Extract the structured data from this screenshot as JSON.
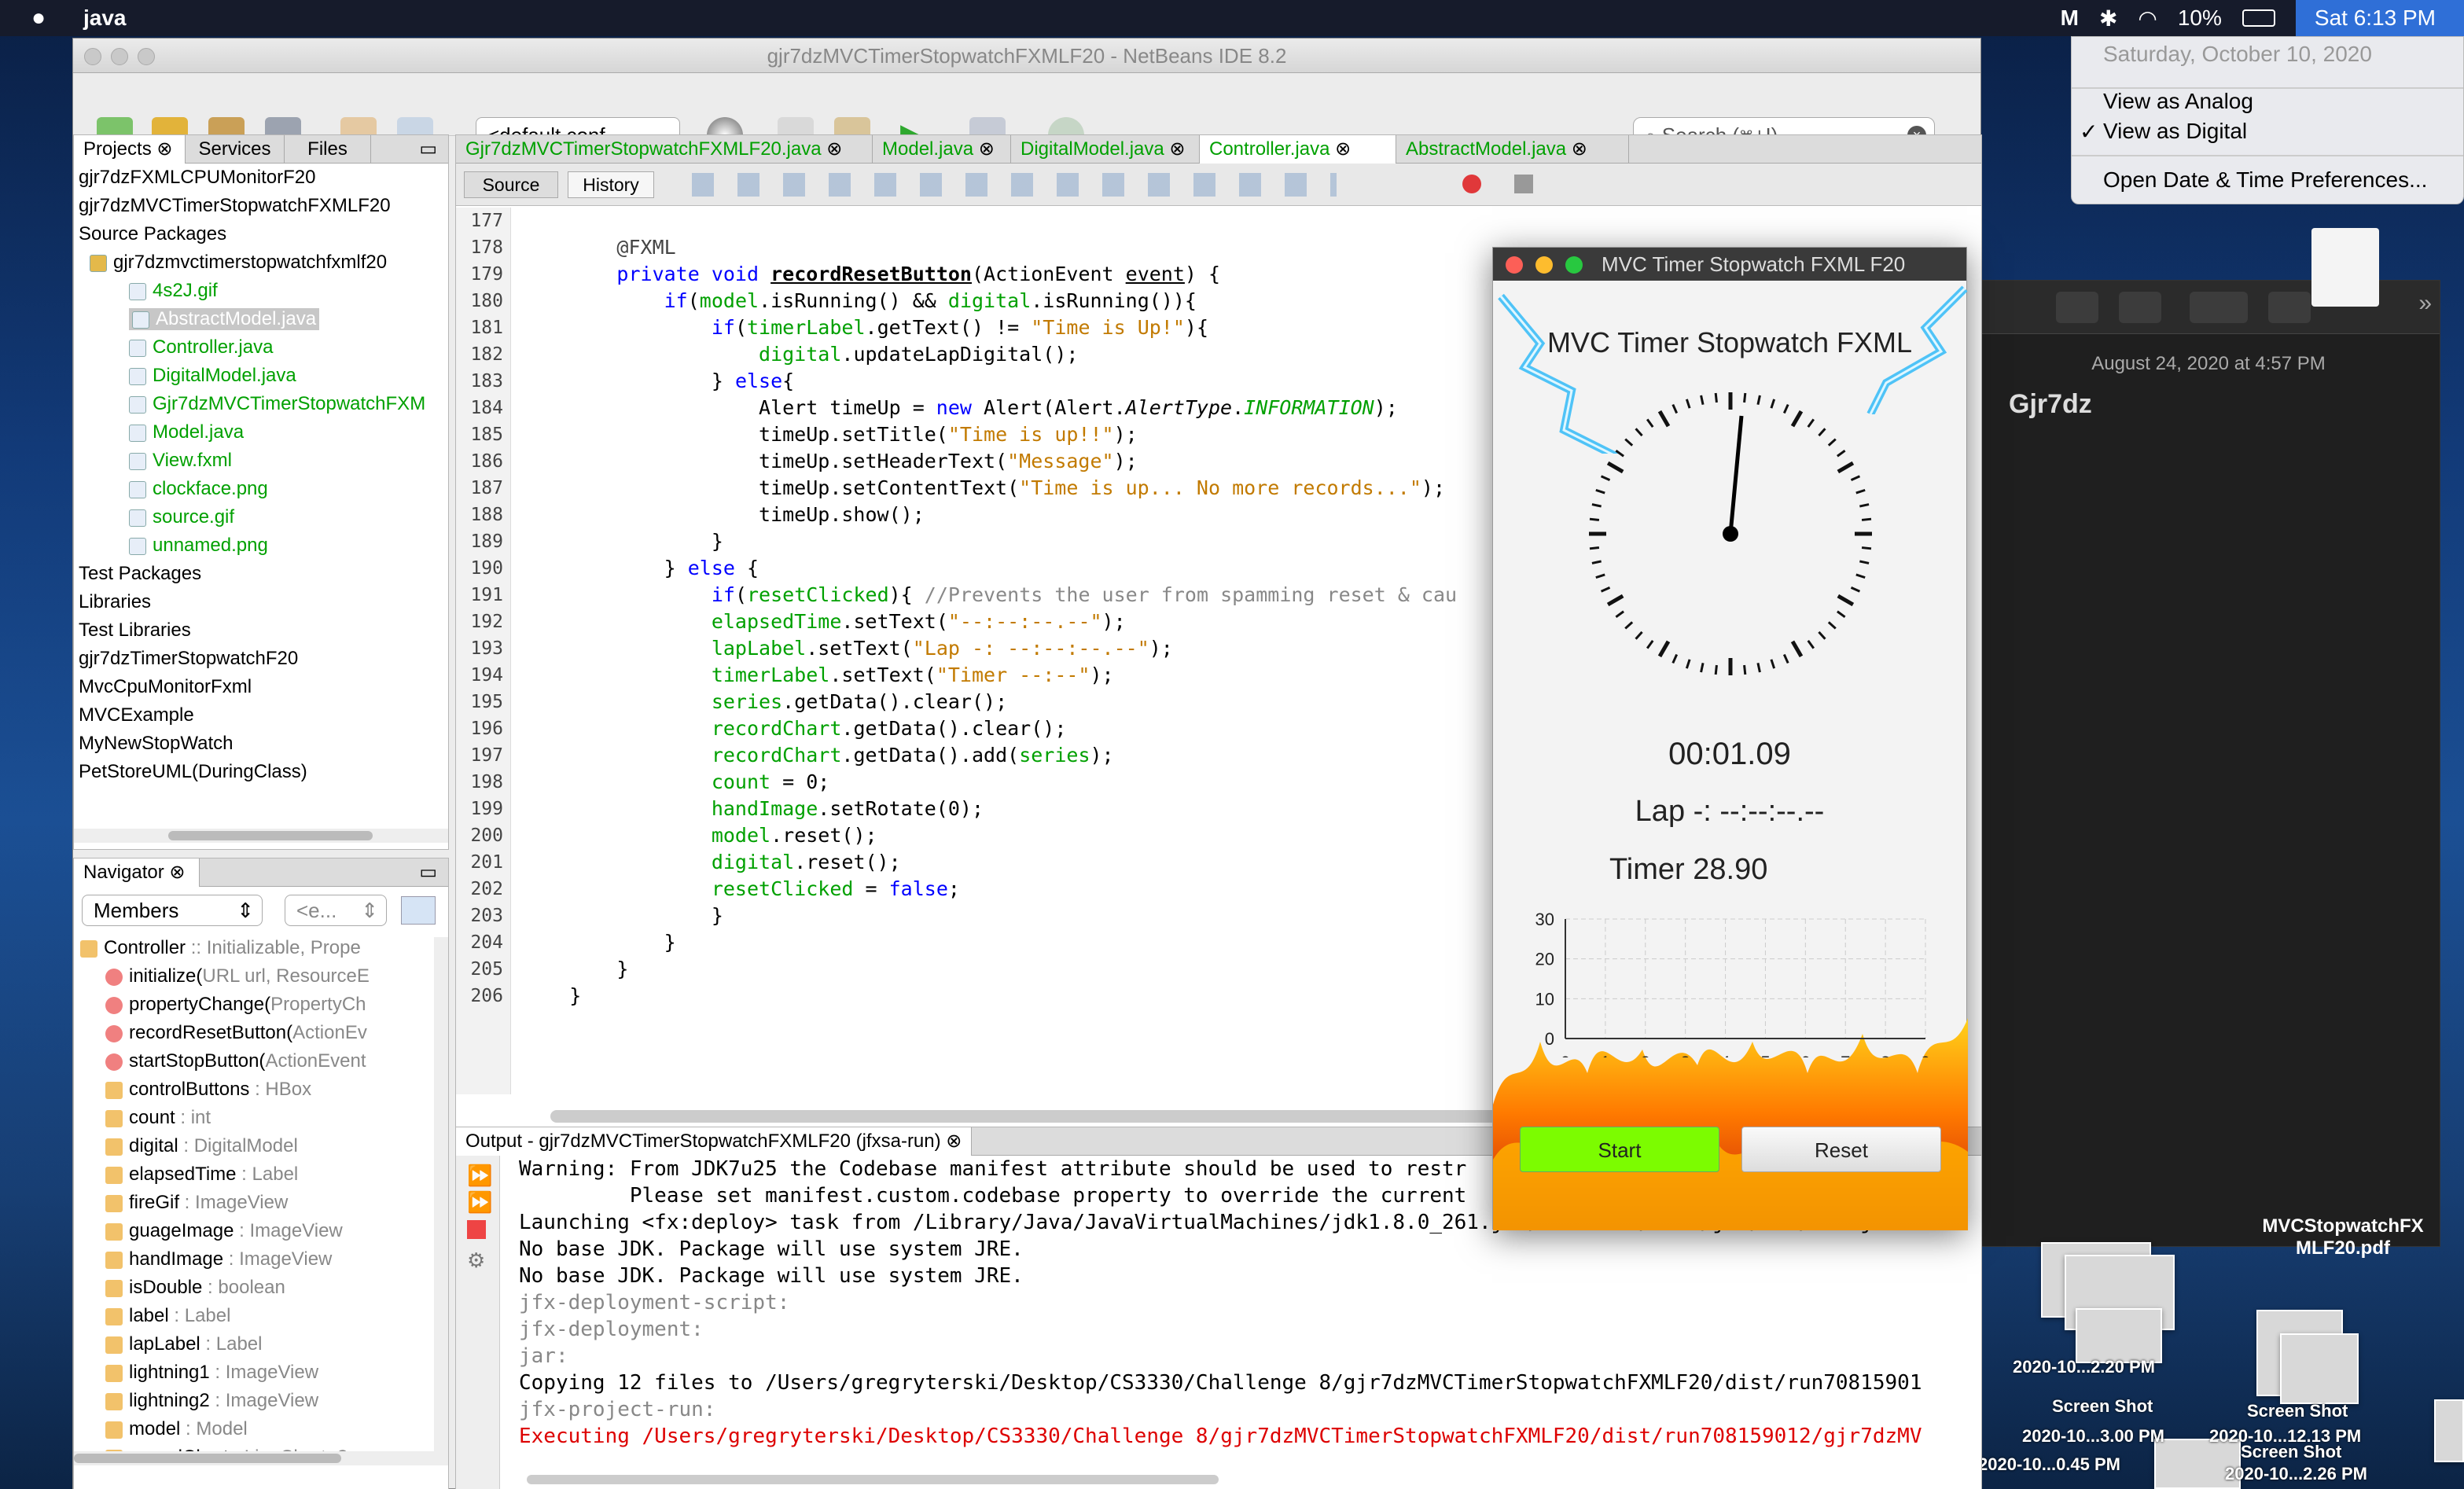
{
  "menubar": {
    "app": "java",
    "battery": "10%",
    "clock": "Sat 6:13 PM"
  },
  "datemenu": {
    "header": "Saturday, October 10, 2020",
    "items": [
      "View as Analog",
      "View as Digital",
      "Open Date & Time Preferences..."
    ],
    "checked": 1
  },
  "netbeans": {
    "title": "gjr7dzMVCTimerStopwatchFXMLF20 - NetBeans IDE 8.2",
    "config": "<default conf...",
    "search_placeholder": "Search (⌘+I)",
    "project_tabs": [
      "Projects",
      "Services",
      "Files"
    ],
    "project_tree": [
      {
        "t": "gjr7dzFXMLCPUMonitorF20",
        "d": 0,
        "c": ""
      },
      {
        "t": "gjr7dzMVCTimerStopwatchFXMLF20",
        "d": 0,
        "c": ""
      },
      {
        "t": "Source Packages",
        "d": 0,
        "c": ""
      },
      {
        "t": "gjr7dzmvctimerstopwatchfxmlf20",
        "d": 1,
        "c": ""
      },
      {
        "t": "4s2J.gif",
        "d": 2,
        "c": "g"
      },
      {
        "t": "AbstractModel.java",
        "d": 2,
        "c": "sel"
      },
      {
        "t": "Controller.java",
        "d": 2,
        "c": "g"
      },
      {
        "t": "DigitalModel.java",
        "d": 2,
        "c": "g"
      },
      {
        "t": "Gjr7dzMVCTimerStopwatchFXM",
        "d": 2,
        "c": "g"
      },
      {
        "t": "Model.java",
        "d": 2,
        "c": "g"
      },
      {
        "t": "View.fxml",
        "d": 2,
        "c": "g"
      },
      {
        "t": "clockface.png",
        "d": 2,
        "c": "g"
      },
      {
        "t": "source.gif",
        "d": 2,
        "c": "g"
      },
      {
        "t": "unnamed.png",
        "d": 2,
        "c": "g"
      },
      {
        "t": "Test Packages",
        "d": 0,
        "c": ""
      },
      {
        "t": "Libraries",
        "d": 0,
        "c": ""
      },
      {
        "t": "Test Libraries",
        "d": 0,
        "c": ""
      },
      {
        "t": "gjr7dzTimerStopwatchF20",
        "d": 0,
        "c": ""
      },
      {
        "t": "MvcCpuMonitorFxml",
        "d": 0,
        "c": ""
      },
      {
        "t": "MVCExample",
        "d": 0,
        "c": ""
      },
      {
        "t": "MyNewStopWatch",
        "d": 0,
        "c": ""
      },
      {
        "t": "PetStoreUML(DuringClass)",
        "d": 0,
        "c": ""
      }
    ],
    "navigator": {
      "title": "Navigator",
      "members": "Members",
      "filter": "<e...",
      "items": [
        {
          "n": "Controller",
          "s": " :: Initializable, Prope",
          "d": 0
        },
        {
          "n": "initialize(",
          "s": "URL url, ResourceE",
          "d": 1
        },
        {
          "n": "propertyChange(",
          "s": "PropertyCh",
          "d": 1
        },
        {
          "n": "recordResetButton(",
          "s": "ActionEv",
          "d": 1
        },
        {
          "n": "startStopButton(",
          "s": "ActionEvent",
          "d": 1
        },
        {
          "n": "controlButtons",
          "s": " : HBox",
          "d": 1
        },
        {
          "n": "count",
          "s": " : int",
          "d": 1
        },
        {
          "n": "digital",
          "s": " : DigitalModel",
          "d": 1
        },
        {
          "n": "elapsedTime",
          "s": " : Label",
          "d": 1
        },
        {
          "n": "fireGif",
          "s": " : ImageView",
          "d": 1
        },
        {
          "n": "guageImage",
          "s": " : ImageView",
          "d": 1
        },
        {
          "n": "handImage",
          "s": " : ImageView",
          "d": 1
        },
        {
          "n": "isDouble",
          "s": " : boolean",
          "d": 1
        },
        {
          "n": "label",
          "s": " : Label",
          "d": 1
        },
        {
          "n": "lapLabel",
          "s": " : Label",
          "d": 1
        },
        {
          "n": "lightning1",
          "s": " : ImageView",
          "d": 1
        },
        {
          "n": "lightning2",
          "s": " : ImageView",
          "d": 1
        },
        {
          "n": "model",
          "s": " : Model",
          "d": 1
        },
        {
          "n": "recordChart",
          "s": " : LineChart<?",
          "d": 1
        }
      ]
    },
    "editor_tabs": [
      "Gjr7dzMVCTimerStopwatchFXMLF20.java",
      "Model.java",
      "DigitalModel.java",
      "Controller.java",
      "AbstractModel.java"
    ],
    "editor_active": 3,
    "source_tab": "Source",
    "history_tab": "History",
    "code": [
      {
        "n": "177",
        "h": ""
      },
      {
        "n": "178",
        "h": "        <span style='color:#444'>@FXML</span>"
      },
      {
        "n": "179",
        "h": "        <span style='color:#00f'>private void</span> <b><u>recordResetButton</u></b>(ActionEvent <u>event</u>) {"
      },
      {
        "n": "180",
        "h": "            <span style='color:#00f'>if</span>(<span class='green'>model</span>.isRunning() &amp;&amp; <span class='green'>digital</span>.isRunning()){"
      },
      {
        "n": "181",
        "h": "                <span style='color:#00f'>if</span>(<span class='green'>timerLabel</span>.getText() != <span style='color:#c27a00'>\"Time is Up!\"</span>){"
      },
      {
        "n": "182",
        "h": "                    <span class='green'>digital</span>.updateLapDigital();"
      },
      {
        "n": "183",
        "h": "                } <span style='color:#00f'>else</span>{"
      },
      {
        "n": "184",
        "h": "                    Alert timeUp = <span style='color:#00f'>new</span> Alert(Alert.<i>AlertType</i>.<i class='green'>INFORMATION</i>);"
      },
      {
        "n": "185",
        "h": "                    timeUp.setTitle(<span style='color:#c27a00'>\"Time is up!!\"</span>);"
      },
      {
        "n": "186",
        "h": "                    timeUp.setHeaderText(<span style='color:#c27a00'>\"Message\"</span>);"
      },
      {
        "n": "187",
        "h": "                    timeUp.setContentText(<span style='color:#c27a00'>\"Time is up... No more records...\"</span>);"
      },
      {
        "n": "188",
        "h": "                    timeUp.show();"
      },
      {
        "n": "189",
        "h": "                }"
      },
      {
        "n": "190",
        "h": "            } <span style='color:#00f'>else</span> {"
      },
      {
        "n": "191",
        "h": "                <span style='color:#00f'>if</span>(<span class='green'>resetClicked</span>){ <span style='color:#888'>//Prevents the user from spamming reset &amp; cau</span>"
      },
      {
        "n": "192",
        "h": "                <span class='green'>elapsedTime</span>.setText(<span style='color:#c27a00'>\"--:--:--.--\"</span>);"
      },
      {
        "n": "193",
        "h": "                <span class='green'>lapLabel</span>.setText(<span style='color:#c27a00'>\"Lap -: --:--:--.--\"</span>);"
      },
      {
        "n": "194",
        "h": "                <span class='green'>timerLabel</span>.setText(<span style='color:#c27a00'>\"Timer --:--\"</span>);"
      },
      {
        "n": "195",
        "h": "                <span class='green'>series</span>.getData().clear();"
      },
      {
        "n": "196",
        "h": "                <span class='green'>recordChart</span>.getData().clear();"
      },
      {
        "n": "197",
        "h": "                <span class='green'>recordChart</span>.getData().add(<span class='green'>series</span>);"
      },
      {
        "n": "198",
        "h": "                <span class='green'>count</span> = 0;"
      },
      {
        "n": "199",
        "h": "                <span class='green'>handImage</span>.setRotate(0);"
      },
      {
        "n": "200",
        "h": "                <span class='green'>model</span>.reset();"
      },
      {
        "n": "201",
        "h": "                <span class='green'>digital</span>.reset();"
      },
      {
        "n": "202",
        "h": "                <span class='green'>resetClicked</span> = <span style='color:#00f'>false</span>;"
      },
      {
        "n": "203",
        "h": "                }"
      },
      {
        "n": "204",
        "h": "            }"
      },
      {
        "n": "205",
        "h": "        }"
      },
      {
        "n": "206",
        "h": "    }"
      }
    ],
    "output": {
      "title": "Output - gjr7dzMVCTimerStopwatchFXMLF20 (jfxsa-run)",
      "lines": [
        {
          "t": "Warning: From JDK7u25 the Codebase manifest attribute should be used to restr",
          "c": "#000"
        },
        {
          "t": "         Please set manifest.custom.codebase property to override the current",
          "c": "#000"
        },
        {
          "t": "Launching <fx:deploy> task from /Library/Java/JavaVirtualMachines/jdk1.8.0_261.jdk/Contents/Home/jre/lib/ant-j",
          "c": "#000"
        },
        {
          "t": "No base JDK. Package will use system JRE.",
          "c": "#000"
        },
        {
          "t": "No base JDK. Package will use system JRE.",
          "c": "#000"
        },
        {
          "t": "jfx-deployment-script:",
          "c": "#888"
        },
        {
          "t": "jfx-deployment:",
          "c": "#888"
        },
        {
          "t": "jar:",
          "c": "#888"
        },
        {
          "t": "Copying 12 files to /Users/gregryterski/Desktop/CS3330/Challenge 8/gjr7dzMVCTimerStopwatchFXMLF20/dist/run70815901",
          "c": "#000"
        },
        {
          "t": "jfx-project-run:",
          "c": "#888"
        },
        {
          "t": "Executing /Users/gregryterski/Desktop/CS3330/Challenge 8/gjr7dzMVCTimerStopwatchFXMLF20/dist/run708159012/gjr7dzMV",
          "c": "#d00"
        }
      ]
    }
  },
  "stopwatch": {
    "title": "MVC Timer Stopwatch FXML F20",
    "heading": "MVC Timer Stopwatch FXML",
    "elapsed": "00:01.09",
    "lap": "Lap -: --:--:--.--",
    "timer": "Timer 28.90",
    "start": "Start",
    "reset": "Reset",
    "start_color": "#7cfc00"
  },
  "chart_data": {
    "type": "line",
    "x_ticks": [
      "0",
      "1",
      "2",
      "3",
      "4",
      "5",
      "6",
      "7",
      "8",
      "9"
    ],
    "y_ticks": [
      "0",
      "10",
      "20",
      "30"
    ],
    "ylim": [
      0,
      30
    ],
    "xlim": [
      0,
      9
    ],
    "series": []
  },
  "notes": {
    "date": "August 24, 2020 at 4:57 PM",
    "title": "Gjr7dz"
  },
  "desktop": {
    "pdf": "MVCStopwatchFX\nMLF20.pdf",
    "shots": [
      "Screen Shot",
      "2020-10...2.20 PM",
      "2020-10...3.00 PM",
      "Screen Shot",
      "2020-10...12.13 PM",
      "2020-10...0.45 PM",
      "2020-10...2.26 PM",
      "Screen Shot"
    ]
  }
}
